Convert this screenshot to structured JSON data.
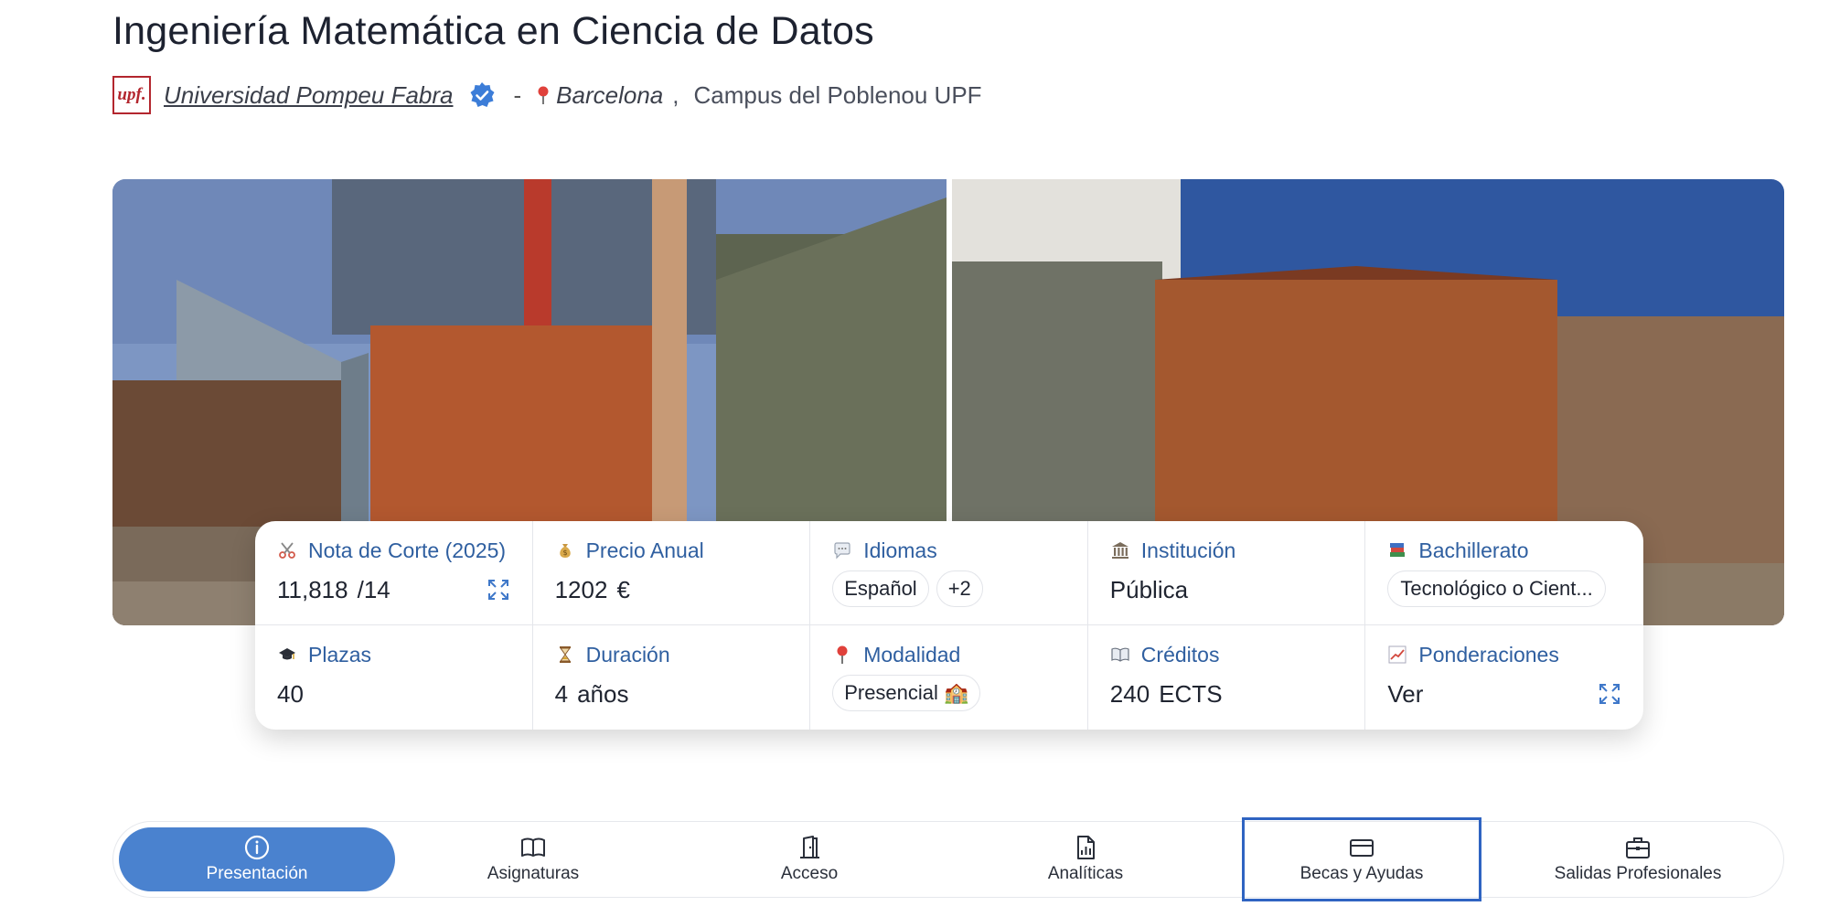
{
  "header": {
    "title": "Ingeniería Matemática en Ciencia de Datos",
    "logo_text": "upf.",
    "university": "Universidad Pompeu Fabra",
    "separator": "-",
    "city": "Barcelona",
    "comma": ",",
    "campus": "Campus del Poblenou UPF"
  },
  "stats": {
    "nota": {
      "icon": "scissors-icon",
      "label": "Nota de Corte (2025)",
      "value": "11,818",
      "max": "/14"
    },
    "precio": {
      "icon": "money-bag-icon",
      "label": "Precio Anual",
      "value": "1202",
      "unit": "€"
    },
    "idiomas": {
      "icon": "speech-bubble-icon",
      "label": "Idiomas",
      "primary": "Español",
      "extra": "+2"
    },
    "institucion": {
      "icon": "classical-building-icon",
      "label": "Institución",
      "value": "Pública"
    },
    "bachillerato": {
      "icon": "books-icon",
      "label": "Bachillerato",
      "value": "Tecnológico o Cient..."
    },
    "plazas": {
      "icon": "graduation-cap-icon",
      "label": "Plazas",
      "value": "40"
    },
    "duracion": {
      "icon": "hourglass-icon",
      "label": "Duración",
      "value": "4",
      "unit": "años"
    },
    "modalidad": {
      "icon": "pin-icon",
      "label": "Modalidad",
      "value": "Presencial 🏫"
    },
    "creditos": {
      "icon": "open-book-icon",
      "label": "Créditos",
      "value": "240",
      "unit": "ECTS"
    },
    "ponderaciones": {
      "icon": "chart-up-icon",
      "label": "Ponderaciones",
      "value": "Ver"
    }
  },
  "tabs": [
    {
      "label": "Presentación",
      "icon": "info-icon",
      "active": true
    },
    {
      "label": "Asignaturas",
      "icon": "book-icon"
    },
    {
      "label": "Acceso",
      "icon": "door-icon"
    },
    {
      "label": "Analíticas",
      "icon": "report-icon"
    },
    {
      "label": "Becas y Ayudas",
      "icon": "credit-card-icon",
      "focused": true
    },
    {
      "label": "Salidas Profesionales",
      "icon": "briefcase-icon"
    }
  ],
  "colors": {
    "accent": "#4a82cf",
    "label_blue": "#2f5fa0",
    "upf_red": "#b3262e",
    "focus_border": "#2f64c2"
  }
}
